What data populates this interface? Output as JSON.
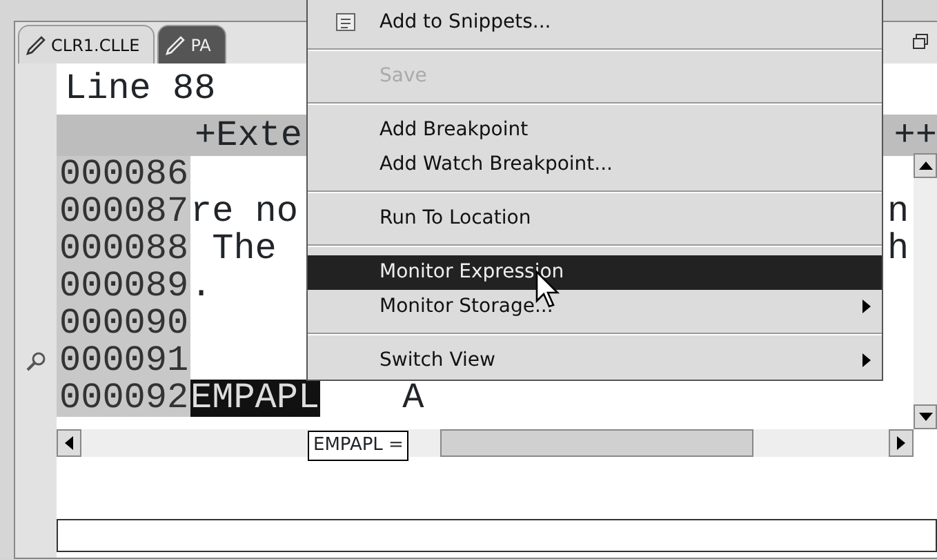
{
  "tabs": [
    {
      "label": "CLR1.CLLE",
      "selected": false
    },
    {
      "label": "PA",
      "selected": true
    }
  ],
  "editor": {
    "position": "Line 88",
    "ruler_left": "+Exte",
    "ruler_right": "++",
    "lines": [
      {
        "number": "000086",
        "marker": false
      },
      {
        "number": "000087",
        "text": "re no",
        "right": "n",
        "marker": false
      },
      {
        "number": "000088",
        "text": " The",
        "right": "h",
        "marker": false
      },
      {
        "number": "000089",
        "text": ".",
        "marker": false
      },
      {
        "number": "000090",
        "marker": false
      },
      {
        "number": "000091",
        "marker": true
      },
      {
        "number": "000092",
        "token": "EMPAPL",
        "text": "A",
        "marker": false
      }
    ],
    "hover_tooltip": "EMPAPL ="
  },
  "context_menu": {
    "items": [
      {
        "kind": "item",
        "label": "Add to Snippets...",
        "icon": true,
        "disabled": false,
        "selected": false,
        "submenu": false
      },
      {
        "kind": "separator"
      },
      {
        "kind": "item",
        "label": "Save",
        "icon": false,
        "disabled": true,
        "selected": false,
        "submenu": false
      },
      {
        "kind": "separator"
      },
      {
        "kind": "item",
        "label": "Add Breakpoint",
        "icon": false,
        "disabled": false,
        "selected": false,
        "submenu": false
      },
      {
        "kind": "item",
        "label": "Add Watch Breakpoint...",
        "icon": false,
        "disabled": false,
        "selected": false,
        "submenu": false
      },
      {
        "kind": "separator"
      },
      {
        "kind": "item",
        "label": "Run To Location",
        "icon": false,
        "disabled": false,
        "selected": false,
        "submenu": false
      },
      {
        "kind": "separator"
      },
      {
        "kind": "item",
        "label": "Monitor Expression",
        "icon": false,
        "disabled": false,
        "selected": true,
        "submenu": false
      },
      {
        "kind": "item",
        "label": "Monitor Storage...",
        "icon": false,
        "disabled": false,
        "selected": false,
        "submenu": true
      },
      {
        "kind": "separator"
      },
      {
        "kind": "item",
        "label": "Switch View",
        "icon": false,
        "disabled": false,
        "selected": false,
        "submenu": true
      }
    ]
  }
}
